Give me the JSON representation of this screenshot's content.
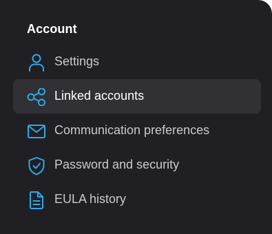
{
  "account_menu": {
    "title": "Account",
    "accent_color": "#2fa8ea",
    "items": [
      {
        "label": "Settings",
        "icon": "user-icon",
        "active": false
      },
      {
        "label": "Linked accounts",
        "icon": "share-nodes-icon",
        "active": true
      },
      {
        "label": "Communication preferences",
        "icon": "envelope-icon",
        "active": false
      },
      {
        "label": "Password and security",
        "icon": "shield-check-icon",
        "active": false
      },
      {
        "label": "EULA history",
        "icon": "document-icon",
        "active": false
      }
    ]
  }
}
